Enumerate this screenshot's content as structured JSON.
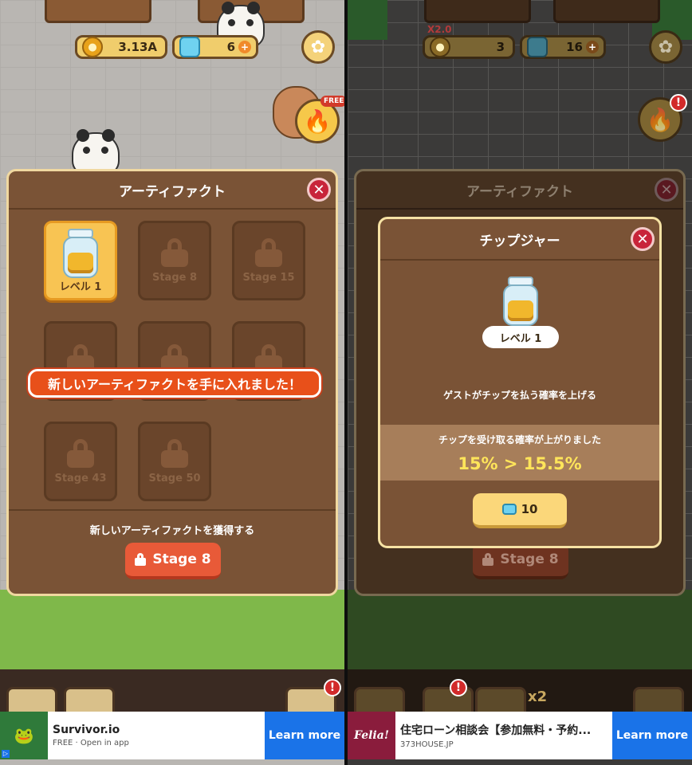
{
  "left": {
    "hud": {
      "coins": "3.13A",
      "gems": "6",
      "plus": "+"
    },
    "free_badge": "FREE",
    "modal": {
      "title": "アーティファクト",
      "close": "✕",
      "slots": [
        {
          "label": "レベル 1",
          "unlocked": true
        },
        {
          "label": "Stage 8"
        },
        {
          "label": "Stage 15"
        },
        {
          "label": ""
        },
        {
          "label": ""
        },
        {
          "label": ""
        },
        {
          "label": "Stage 43"
        },
        {
          "label": "Stage 50"
        }
      ],
      "notice": "新しいアーティファクトを手に入れました！",
      "footer_text": "新しいアーティファクトを獲得する",
      "stage_button": "Stage 8"
    },
    "ad": {
      "title": "Survivor.io",
      "sub": "FREE · Open in app",
      "cta": "Learn more",
      "info": "▷"
    }
  },
  "right": {
    "multiplier": "X2.0",
    "hud": {
      "coins": "3",
      "gems": "16",
      "plus": "+"
    },
    "excl": "!",
    "modal": {
      "title": "アーティファクト",
      "close": "✕",
      "stage_button": "Stage 8"
    },
    "detail": {
      "title": "チップジャー",
      "close": "✕",
      "level": "レベル 1",
      "description": "ゲストがチップを払う確率を上げる",
      "stat_label": "チップを受け取る確率が上がりました",
      "stat_value": "15% > 15.5%",
      "price": "10"
    },
    "nav_badge": "x2",
    "ad": {
      "thumb": "Felia!",
      "title": "住宅ローン相談会【参加無料・予約...",
      "sub": "373HOUSE.JP",
      "cta": "Learn more",
      "info": "▷"
    }
  },
  "icons": [
    "coin-icon",
    "gem-icon",
    "flower-icon",
    "fire-icon",
    "lock-icon",
    "jar-icon",
    "close-icon"
  ]
}
